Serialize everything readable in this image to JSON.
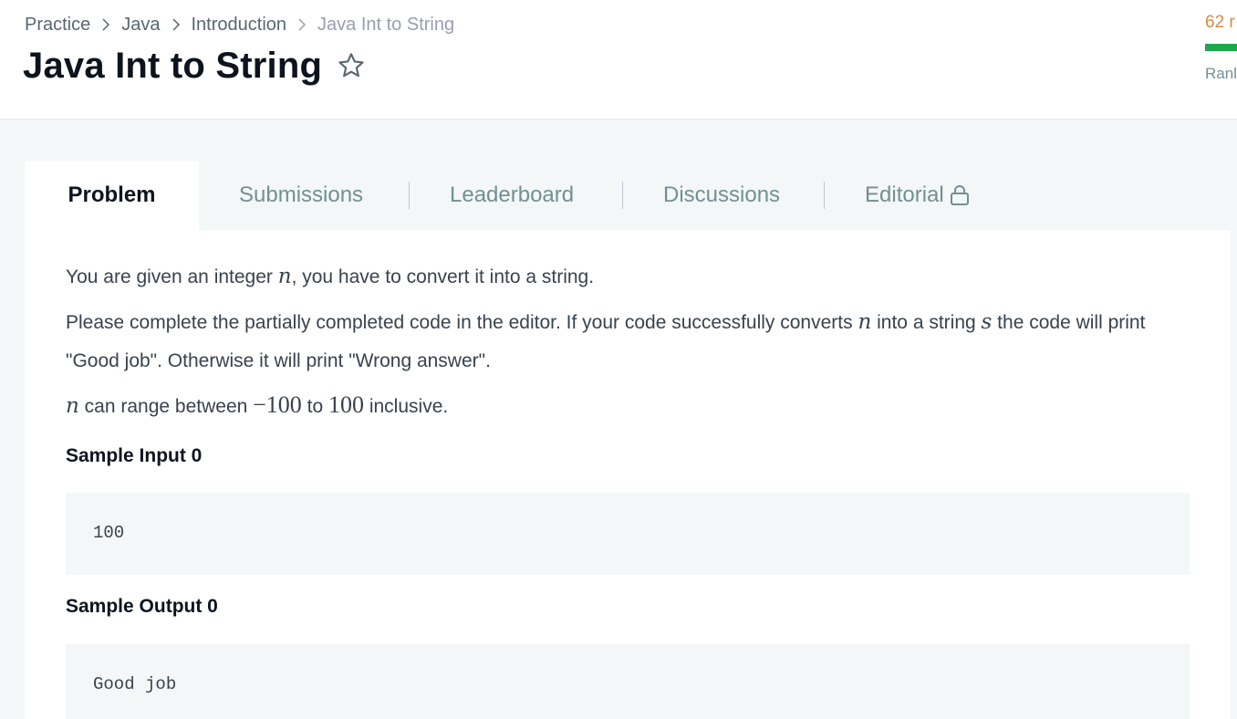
{
  "breadcrumb": {
    "items": [
      "Practice",
      "Java",
      "Introduction"
    ],
    "current": "Java Int to String"
  },
  "page": {
    "title": "Java Int to String",
    "star_icon": "star-outline-icon"
  },
  "score": {
    "points_text": "62 r",
    "rank_label": "Ranl",
    "progress_color": "#1ba94c",
    "points_color": "#d68c45"
  },
  "tabs": [
    {
      "label": "Problem",
      "active": true
    },
    {
      "label": "Submissions",
      "active": false
    },
    {
      "label": "Leaderboard",
      "active": false
    },
    {
      "label": "Discussions",
      "active": false
    },
    {
      "label": "Editorial",
      "active": false,
      "icon": "lock-icon"
    }
  ],
  "problem": {
    "p1_before": "You are given an integer ",
    "var_n": "n",
    "p1_after": ", you have to convert it into a string.",
    "p2_part1": "Please complete the partially completed code in the editor. If your code successfully converts ",
    "p2_part2": " into a string ",
    "var_s": "s",
    "p2_part3": " the code will print \"Good job\". Otherwise it will print \"Wrong answer\".",
    "p3_part1": " can range between ",
    "min_value": "−100",
    "p3_part2": " to ",
    "max_value": "100",
    "p3_part3": " inclusive.",
    "sample_input_title": "Sample Input 0",
    "sample_input": "100",
    "sample_output_title": "Sample Output 0",
    "sample_output": "Good job"
  }
}
